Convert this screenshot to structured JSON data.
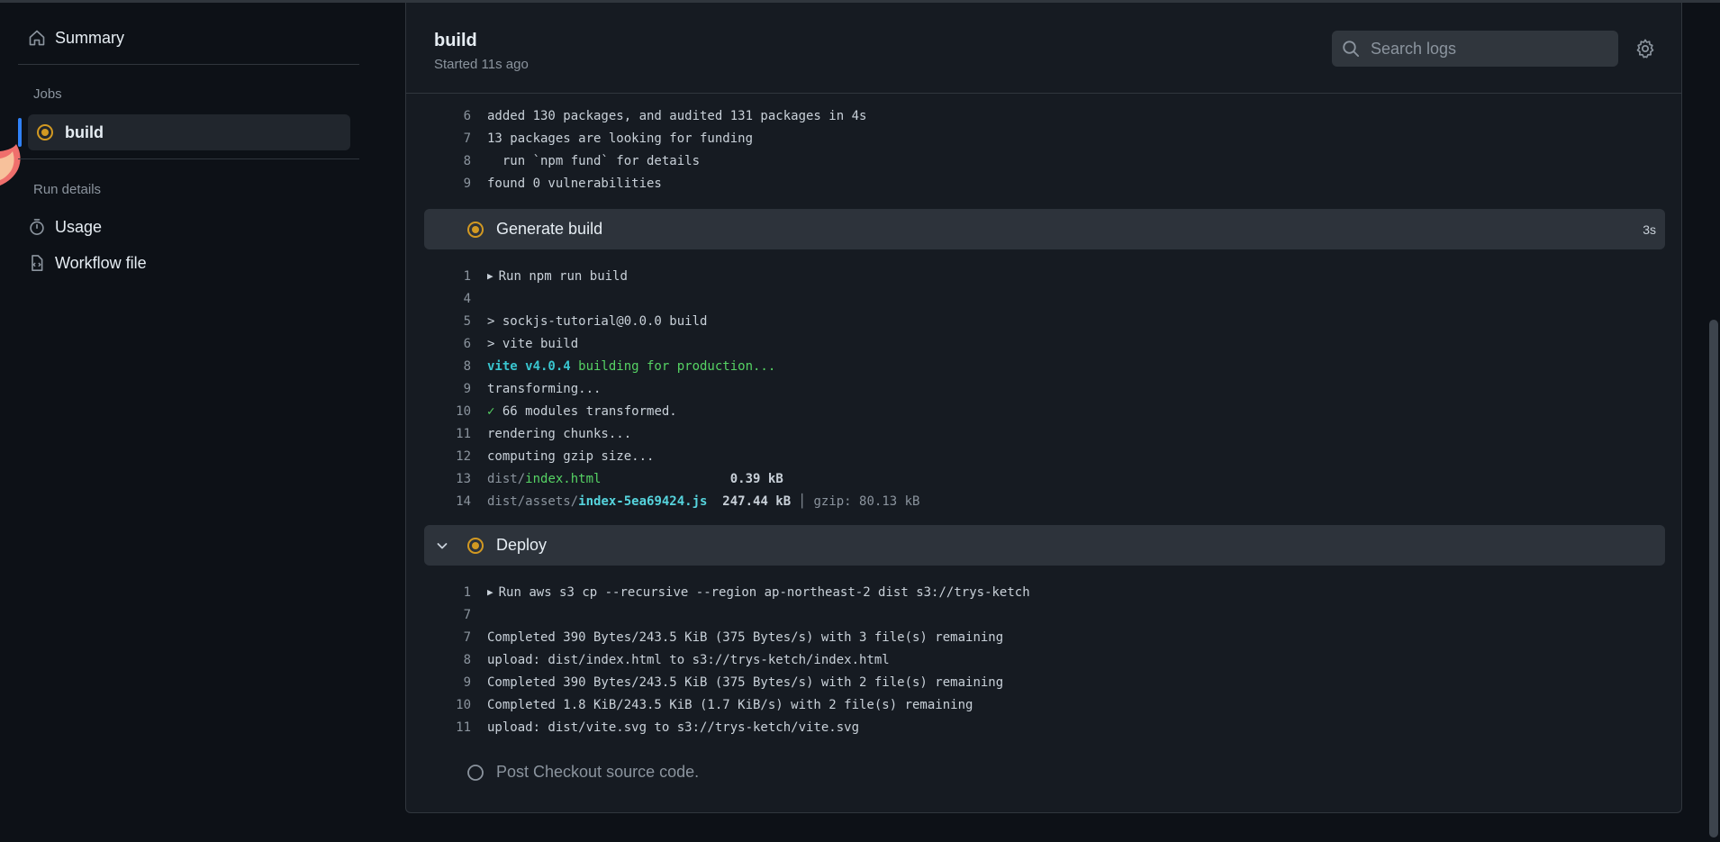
{
  "sidebar": {
    "summary_label": "Summary",
    "jobs_heading": "Jobs",
    "job_label": "build",
    "run_details_heading": "Run details",
    "usage_label": "Usage",
    "workflow_label": "Workflow file"
  },
  "header": {
    "title": "build",
    "subtitle": "Started 11s ago",
    "search_placeholder": "Search logs"
  },
  "install_log": [
    {
      "n": "6",
      "text": "added 130 packages, and audited 131 packages in 4s"
    },
    {
      "n": "7",
      "text": "13 packages are looking for funding"
    },
    {
      "n": "8",
      "text": "  run `npm fund` for details"
    },
    {
      "n": "9",
      "text": "found 0 vulnerabilities"
    }
  ],
  "generate_step": {
    "name": "Generate build",
    "duration": "3s",
    "lines": {
      "l1": {
        "n": "1",
        "text": "Run npm run build"
      },
      "l4": {
        "n": "4"
      },
      "l5": {
        "n": "5",
        "text": "> sockjs-tutorial@0.0.0 build"
      },
      "l6": {
        "n": "6",
        "text": "> vite build"
      },
      "l8": {
        "n": "8",
        "a": "vite v4.0.4",
        "b": " building for production..."
      },
      "l9": {
        "n": "9",
        "text": "transforming..."
      },
      "l10": {
        "n": "10",
        "a": "✓",
        "b": " 66 modules transformed."
      },
      "l11": {
        "n": "11",
        "text": "rendering chunks..."
      },
      "l12": {
        "n": "12",
        "text": "computing gzip size..."
      },
      "l13": {
        "n": "13",
        "a": "dist/",
        "b": "index.html",
        "c": "                 0.39 kB"
      },
      "l14": {
        "n": "14",
        "a": "dist/assets/",
        "b": "index-5ea69424.js",
        "c": "  247.44 kB",
        "d": " │ gzip: 80.13 kB"
      }
    }
  },
  "deploy_step": {
    "name": "Deploy",
    "lines": {
      "l1": {
        "n": "1",
        "text": "Run aws s3 cp --recursive --region ap-northeast-2 dist s3://trys-ketch"
      },
      "l2": {
        "n": "7"
      },
      "l3": {
        "n": "7",
        "text": "Completed 390 Bytes/243.5 KiB (375 Bytes/s) with 3 file(s) remaining"
      },
      "l4": {
        "n": "8",
        "text": "upload: dist/index.html to s3://trys-ketch/index.html"
      },
      "l5": {
        "n": "9",
        "text": "Completed 390 Bytes/243.5 KiB (375 Bytes/s) with 2 file(s) remaining"
      },
      "l6": {
        "n": "10",
        "text": "Completed 1.8 KiB/243.5 KiB (1.7 KiB/s) with 2 file(s) remaining"
      },
      "l7": {
        "n": "11",
        "text": "upload: dist/vite.svg to s3://trys-ketch/vite.svg"
      }
    }
  },
  "post_step": {
    "name": "Post Checkout source code."
  },
  "colors": {
    "accent": "#2f81f7",
    "in_progress": "#d29922",
    "cyan": "#39c5cf",
    "green": "#56d364"
  }
}
